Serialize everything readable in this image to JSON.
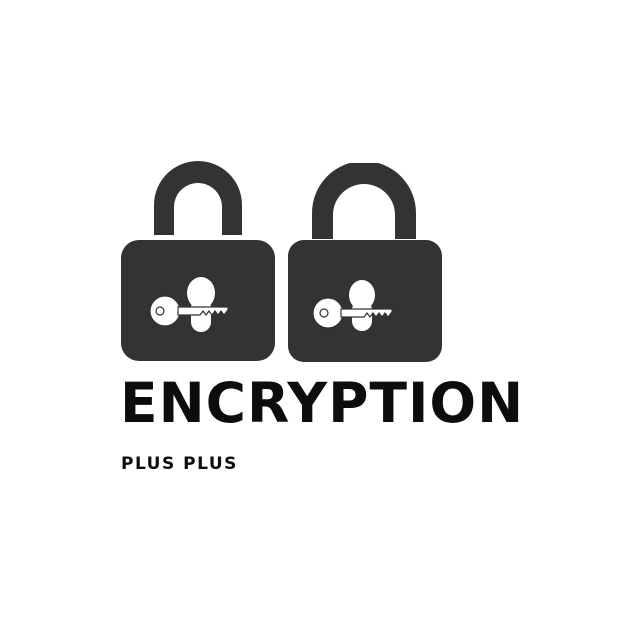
{
  "logo": {
    "title": "ENCRYPTION",
    "subtitle": "PLUS PLUS",
    "icons": [
      "padlock-icon",
      "key-icon",
      "padlock-icon",
      "key-icon"
    ]
  },
  "colors": {
    "background": "#ffffff",
    "lock_body": "#333333",
    "shackle": "#333333",
    "text": "#0d0d0d",
    "keyhole": "#ffffff"
  }
}
